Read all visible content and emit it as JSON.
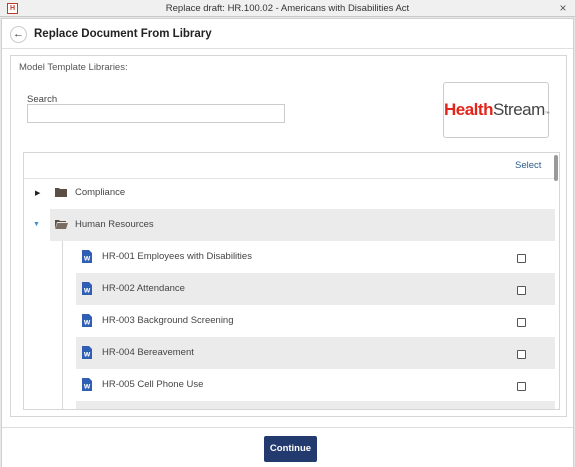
{
  "window": {
    "title": "Replace draft: HR.100.02 - Americans with Disabilities Act",
    "app_icon_text": "H"
  },
  "dialog": {
    "title": "Replace Document From Library"
  },
  "libraries": {
    "section_label": "Model Template Libraries:",
    "search_label": "Search",
    "search_value": "",
    "logo": {
      "health": "Health",
      "stream": "Stream",
      "tm": "™"
    }
  },
  "tree": {
    "select_label": "Select",
    "folders": [
      {
        "label": "Compliance",
        "expanded": false
      },
      {
        "label": "Human Resources",
        "expanded": true
      }
    ],
    "documents": [
      {
        "label": "HR-001 Employees with Disabilities",
        "checked": false
      },
      {
        "label": "HR-002 Attendance",
        "checked": false
      },
      {
        "label": "HR-003 Background Screening",
        "checked": false
      },
      {
        "label": "HR-004 Bereavement",
        "checked": false
      },
      {
        "label": "HR-005 Cell Phone Use",
        "checked": false
      }
    ]
  },
  "footer": {
    "continue_label": "Continue"
  },
  "colors": {
    "accent": "#233a6e",
    "link": "#2b5c8a",
    "brand_red": "#e1251b",
    "row_shade": "#ebebeb"
  }
}
